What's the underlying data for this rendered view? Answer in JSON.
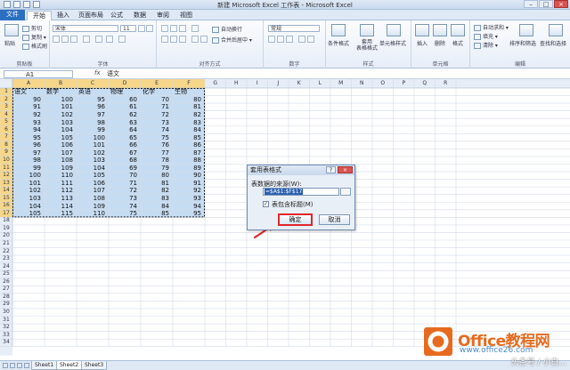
{
  "window": {
    "title": "新建 Microsoft Excel 工作表 - Microsoft Excel",
    "controls": [
      "–",
      "□",
      "×"
    ]
  },
  "ribbon": {
    "tabs": [
      "文件",
      "开始",
      "插入",
      "页面布局",
      "公式",
      "数据",
      "审阅",
      "视图"
    ],
    "active_tab": "开始",
    "clipboard": {
      "paste": "粘贴",
      "cut": "剪切",
      "copy": "复制 ▾",
      "format_painter": "格式刷",
      "label": "剪贴板"
    },
    "font": {
      "name": "宋体",
      "size": "11",
      "label": "字体"
    },
    "alignment": {
      "wrap": "自动换行",
      "merge": "合并后居中 ▾",
      "label": "对齐方式"
    },
    "number": {
      "format": "常规",
      "label": "数字"
    },
    "styles": {
      "conditional": "条件格式",
      "table_format": "套用\n表格格式",
      "cell_styles": "单元格样式",
      "label": "样式"
    },
    "cells": {
      "insert": "插入",
      "delete": "删除",
      "format": "格式",
      "label": "单元格"
    },
    "editing": {
      "autosum": "自动求和 ▾",
      "fill": "填充 ▾",
      "clear": "清除 ▾",
      "sort": "排序和筛选",
      "find": "查找和选择",
      "label": "编辑"
    }
  },
  "formula_bar": {
    "name_box": "A1",
    "fx": "fx",
    "value": "语文"
  },
  "grid": {
    "columns": [
      "A",
      "B",
      "C",
      "D",
      "E",
      "F",
      "G",
      "H",
      "I",
      "J",
      "K",
      "L",
      "M",
      "N",
      "O",
      "P",
      "Q",
      "R"
    ],
    "rows": [
      "1",
      "2",
      "3",
      "4",
      "5",
      "6",
      "7",
      "8",
      "9",
      "10",
      "11",
      "12",
      "13",
      "14",
      "15",
      "16",
      "17",
      "18",
      "19",
      "20",
      "21",
      "22",
      "23",
      "24",
      "25",
      "26",
      "27",
      "28",
      "29",
      "30",
      "31",
      "32",
      "33",
      "34"
    ],
    "headers": [
      "语文",
      "数学",
      "英语",
      "物理",
      "化学",
      "生物"
    ],
    "data": [
      [
        90,
        100,
        95,
        60,
        70,
        80
      ],
      [
        91,
        101,
        96,
        61,
        71,
        81
      ],
      [
        92,
        102,
        97,
        62,
        72,
        82
      ],
      [
        93,
        103,
        98,
        63,
        73,
        83
      ],
      [
        94,
        104,
        99,
        64,
        74,
        84
      ],
      [
        95,
        105,
        100,
        65,
        75,
        85
      ],
      [
        96,
        106,
        101,
        66,
        76,
        86
      ],
      [
        97,
        107,
        102,
        67,
        77,
        87
      ],
      [
        98,
        108,
        103,
        68,
        78,
        88
      ],
      [
        99,
        109,
        104,
        69,
        79,
        89
      ],
      [
        100,
        110,
        105,
        70,
        80,
        90
      ],
      [
        101,
        111,
        106,
        71,
        81,
        91
      ],
      [
        102,
        112,
        107,
        72,
        82,
        92
      ],
      [
        103,
        113,
        108,
        73,
        83,
        93
      ],
      [
        104,
        114,
        109,
        74,
        84,
        94
      ],
      [
        105,
        115,
        110,
        75,
        85,
        95
      ]
    ]
  },
  "dialog": {
    "title": "套用表格式",
    "help": "?",
    "close": "×",
    "source_label": "表数据的来源(W):",
    "range": "=$A$1:$F$17",
    "has_headers_label": "表包含标题(M)",
    "has_headers_checked": "✓",
    "ok": "确定",
    "cancel": "取消"
  },
  "sheets": {
    "tabs": [
      "Sheet1",
      "Sheet2",
      "Sheet3"
    ],
    "active": "Sheet2"
  },
  "watermark": {
    "brand": "Office教程网",
    "site": "www.office26.com",
    "source": "头条号 / 小白..."
  },
  "colors": {
    "selection": "#c6dcf2",
    "accent": "#2a6fc1",
    "highlight": "#e0262c"
  }
}
